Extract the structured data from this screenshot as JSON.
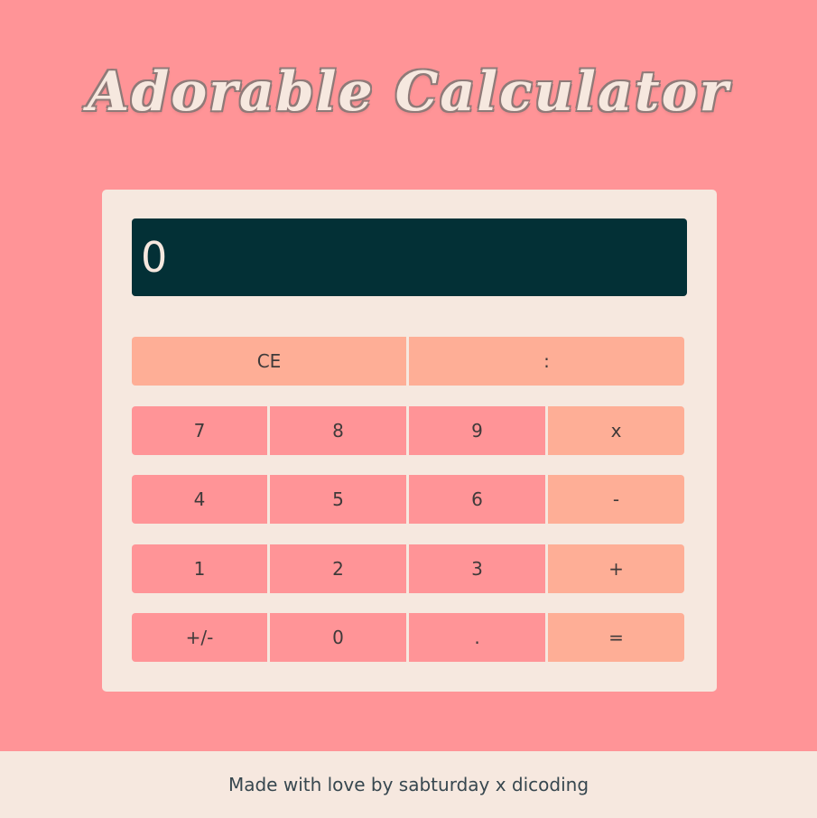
{
  "page": {
    "title": "Adorable Calculator",
    "footer": "Made with love by sabturday x dicoding"
  },
  "calculator": {
    "display_value": "0",
    "rows": [
      [
        "CE",
        ":"
      ],
      [
        "7",
        "8",
        "9",
        "x"
      ],
      [
        "4",
        "5",
        "6",
        "-"
      ],
      [
        "1",
        "2",
        "3",
        "+"
      ],
      [
        "+/-",
        "0",
        ".",
        "="
      ]
    ]
  },
  "colors": {
    "background": "#ff9497",
    "panel": "#f6e8df",
    "display": "#033036",
    "number_button": "#ff9497",
    "operator_button": "#feae96"
  }
}
